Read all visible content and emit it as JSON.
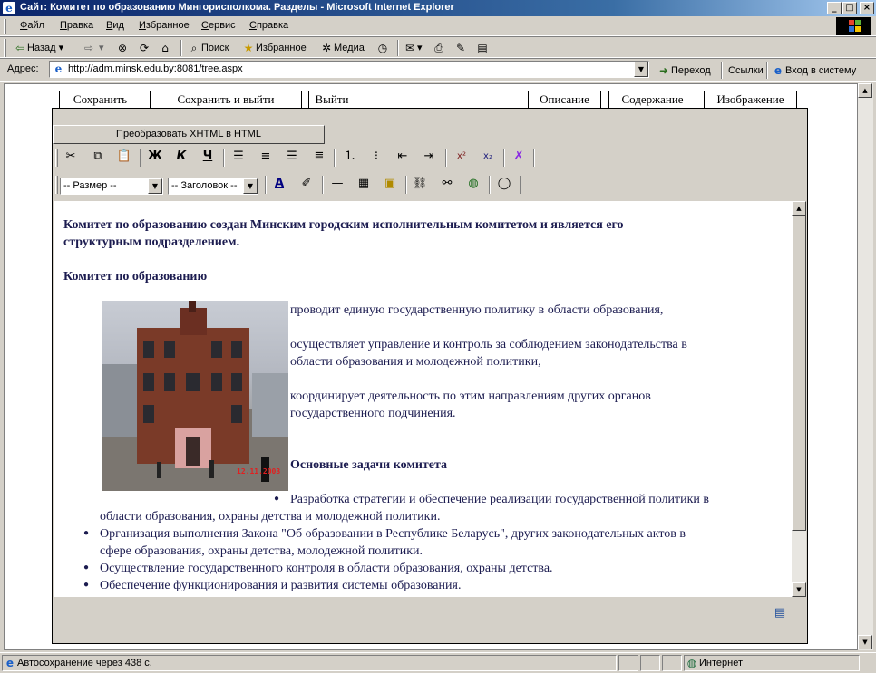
{
  "window": {
    "title": "Сайт: Комитет по образованию Мингорисполкома. Разделы - Microsoft Internet Explorer",
    "buttons": [
      "_",
      "□",
      "×"
    ]
  },
  "menu": {
    "items": [
      {
        "pre": "",
        "key": "Ф",
        "post": "айл"
      },
      {
        "pre": "",
        "key": "П",
        "post": "равка"
      },
      {
        "pre": "",
        "key": "В",
        "post": "ид"
      },
      {
        "pre": "",
        "key": "И",
        "post": "збранное"
      },
      {
        "pre": "",
        "key": "С",
        "post": "ервис"
      },
      {
        "pre": "",
        "key": "С",
        "post": "правка"
      }
    ]
  },
  "nav_toolbar": {
    "back_label": "Назад",
    "search_label": "Поиск",
    "favorites_label": "Избранное",
    "media_label": "Медиа"
  },
  "address_bar": {
    "label": "Адрес:",
    "url": "http://adm.minsk.edu.by:8081/tree.aspx",
    "go_label": "Переход",
    "links_label": "Ссылки",
    "login_label": "Вход в систему"
  },
  "editor": {
    "buttons": {
      "save": "Сохранить",
      "save_exit": "Сохранить и выйти",
      "exit": "Выйти"
    },
    "tabs": {
      "description": "Описание",
      "content": "Содержание",
      "image": "Изображение"
    },
    "convert_button": "Преобразовать XHTML в HTML",
    "format_labels": {
      "bold": "Ж",
      "italic": "К",
      "underline": "Ч",
      "superscript": "x²",
      "subscript": "x₂"
    },
    "size_select": "-- Размер --",
    "heading_select": "-- Заголовок --"
  },
  "document": {
    "intro_line1": "Комитет по образованию создан Минским городским исполнительным комитетом и является его",
    "intro_line2": "структурным подразделением.",
    "section_title": "Комитет по образованию",
    "para1": "проводит единую государственную политику в области образования,",
    "para2_line1": "осуществляет управление и контроль за соблюдением   законодательства в",
    "para2_line2": "области образования и молодежной политики,",
    "para3_line1": "координирует деятельность по этим направлениям других органов",
    "para3_line2": "государственного подчинения.",
    "tasks_title": "Основные задачи комитета",
    "photo_date": "12.11.2003",
    "tasks": [
      {
        "line1": "Разработка стратегии и обеспечение реализации государственной политики в",
        "line2": "области образования, охраны детства и молодежной политики."
      },
      {
        "line1": "Организация выполнения Закона \"Об образовании в Республике Беларусь\", других законодательных актов в",
        "line2": "сфере образования, охраны детства, молодежной политики."
      },
      {
        "line1": "Осуществление государственного контроля в области образования, охраны детства.",
        "line2": ""
      },
      {
        "line1": "Обеспечение функционирования и развития системы образования.",
        "line2": ""
      }
    ]
  },
  "status_bar": {
    "message": "Автосохранение через 438 с.",
    "zone": "Интернет"
  }
}
